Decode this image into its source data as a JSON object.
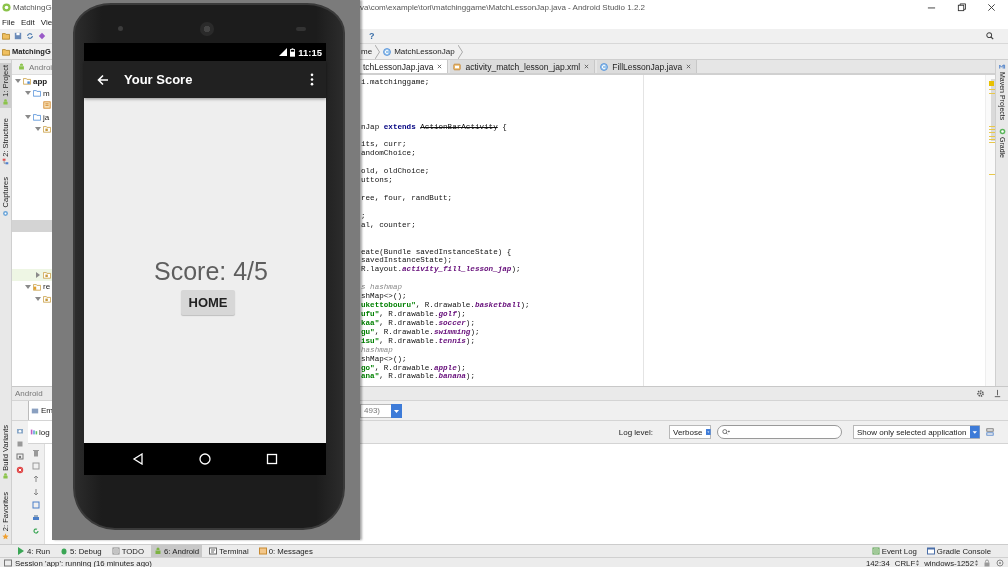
{
  "window": {
    "app_name": "MatchingG",
    "title": "va\\com\\example\\tori\\matchinggame\\MatchLessonJap.java - Android Studio 1.2.2"
  },
  "menu": [
    {
      "label": "File"
    },
    {
      "label": "Edit"
    },
    {
      "label": "Vie"
    }
  ],
  "toolbar": {
    "help": "?"
  },
  "navigation_bar": {
    "project": "MatchingG",
    "crumbs": [
      {
        "label": "me"
      },
      {
        "label": "MatchLessonJap",
        "kind": "class"
      }
    ]
  },
  "left_tool_stripe": {
    "top": [
      {
        "label": "1: Project",
        "kind": "project",
        "selected": true
      },
      {
        "label": "2: Structure",
        "kind": "structure",
        "selected": false
      },
      {
        "label": "Captures",
        "kind": "captures",
        "selected": false
      }
    ],
    "bottom": [
      {
        "label": "Build Variants",
        "kind": "variants",
        "selected": false
      },
      {
        "label": "2: Favorites",
        "kind": "favorites",
        "selected": false
      }
    ]
  },
  "project_panel": {
    "view": "Androi",
    "tree": [
      {
        "label": "app",
        "kind": "module",
        "expanded": true,
        "children": [
          {
            "label": "m",
            "kind": "folder",
            "expanded": true,
            "children": [
              {
                "kind": "file"
              }
            ]
          },
          {
            "label": "ja",
            "kind": "folder",
            "expanded": true,
            "children": [
              {
                "kind": "package",
                "expanded": true,
                "children": [
                  {
                    "selected": false
                  },
                  {
                    "selected": false
                  },
                  {
                    "selected": false
                  },
                  {
                    "selected": false
                  },
                  {
                    "selected": false
                  },
                  {
                    "selected": false
                  },
                  {
                    "selected": false
                  },
                  {
                    "selected": true
                  },
                  {
                    "selected": false
                  },
                  {
                    "selected": false
                  },
                  {
                    "selected": false
                  }
                ]
              },
              {
                "kind": "package",
                "expanded": false,
                "color": "#eef6e4"
              }
            ]
          },
          {
            "label": "re",
            "kind": "res",
            "expanded": true,
            "children": [
              {
                "kind": "package",
                "expanded": true
              }
            ]
          }
        ]
      }
    ]
  },
  "editor_tabs": [
    {
      "label": "tchLessonJap.java",
      "selected": true
    },
    {
      "label": "activity_match_lesson_jap.xml",
      "kind": "xml",
      "selected": false
    },
    {
      "label": "FillLessonJap.java",
      "kind": "class",
      "selected": false
    }
  ],
  "code_lines": [
    {
      "kind": "code",
      "segments": [
        {
          "text": "i.matchinggame;",
          "kind": "plain"
        }
      ]
    },
    {
      "kind": "blank"
    },
    {
      "kind": "blank"
    },
    {
      "kind": "blank"
    },
    {
      "kind": "blank"
    },
    {
      "kind": "code",
      "segments": [
        {
          "text": "nJap ",
          "kind": "plain"
        },
        {
          "text": "extends ",
          "kind": "keyword"
        },
        {
          "text": "ActionBarActivity",
          "kind": "deprecated"
        },
        {
          "text": " {",
          "kind": "plain"
        }
      ]
    },
    {
      "kind": "blank"
    },
    {
      "kind": "code",
      "segments": [
        {
          "text": "its, curr;",
          "kind": "plain"
        }
      ]
    },
    {
      "kind": "code",
      "segments": [
        {
          "text": "andomChoice;",
          "kind": "plain"
        }
      ]
    },
    {
      "kind": "blank"
    },
    {
      "kind": "code",
      "segments": [
        {
          "text": "old, oldChoice;",
          "kind": "plain"
        }
      ]
    },
    {
      "kind": "code",
      "segments": [
        {
          "text": "uttons;",
          "kind": "plain"
        }
      ]
    },
    {
      "kind": "blank"
    },
    {
      "kind": "code",
      "segments": [
        {
          "text": "ree, four, randButt;",
          "kind": "plain"
        }
      ]
    },
    {
      "kind": "blank"
    },
    {
      "kind": "code",
      "segments": [
        {
          "text": ";",
          "kind": "plain"
        }
      ]
    },
    {
      "kind": "code",
      "segments": [
        {
          "text": "al, counter;",
          "kind": "plain"
        }
      ]
    },
    {
      "kind": "blank"
    },
    {
      "kind": "blank"
    },
    {
      "kind": "code",
      "segments": [
        {
          "text": "eate(Bundle savedInstanceState) {",
          "kind": "plain"
        }
      ]
    },
    {
      "kind": "code",
      "segments": [
        {
          "text": "savedInstanceState);",
          "kind": "plain"
        }
      ]
    },
    {
      "kind": "code",
      "segments": [
        {
          "text": "R.layout.",
          "kind": "plain"
        },
        {
          "text": "activity_fill_lesson_jap",
          "kind": "field"
        },
        {
          "text": ");",
          "kind": "plain"
        }
      ]
    },
    {
      "kind": "blank"
    },
    {
      "kind": "code",
      "segments": [
        {
          "text": "s hashmap",
          "kind": "comment"
        }
      ]
    },
    {
      "kind": "code",
      "segments": [
        {
          "text": "shMap<>();",
          "kind": "plain"
        }
      ]
    },
    {
      "kind": "code",
      "segments": [
        {
          "text": "ukettobouru\"",
          "kind": "string"
        },
        {
          "text": ", R.drawable.",
          "kind": "plain"
        },
        {
          "text": "basketball",
          "kind": "field"
        },
        {
          "text": ");",
          "kind": "plain"
        }
      ]
    },
    {
      "kind": "code",
      "segments": [
        {
          "text": "ufu\"",
          "kind": "string"
        },
        {
          "text": ", R.drawable.",
          "kind": "plain"
        },
        {
          "text": "golf",
          "kind": "field"
        },
        {
          "text": ");",
          "kind": "plain"
        }
      ]
    },
    {
      "kind": "code",
      "segments": [
        {
          "text": "kaa\"",
          "kind": "string"
        },
        {
          "text": ", R.drawable.",
          "kind": "plain"
        },
        {
          "text": "soccer",
          "kind": "field"
        },
        {
          "text": ");",
          "kind": "plain"
        }
      ]
    },
    {
      "kind": "code",
      "segments": [
        {
          "text": "gu\"",
          "kind": "string"
        },
        {
          "text": ", R.drawable.",
          "kind": "plain"
        },
        {
          "text": "swimming",
          "kind": "field"
        },
        {
          "text": ");",
          "kind": "plain"
        }
      ]
    },
    {
      "kind": "code",
      "segments": [
        {
          "text": "isu\"",
          "kind": "string"
        },
        {
          "text": ", R.drawable.",
          "kind": "plain"
        },
        {
          "text": "tennis",
          "kind": "field"
        },
        {
          "text": ");",
          "kind": "plain"
        }
      ]
    },
    {
      "kind": "code",
      "segments": [
        {
          "text": "hashmap",
          "kind": "comment"
        }
      ]
    },
    {
      "kind": "code",
      "segments": [
        {
          "text": "shMap<>();",
          "kind": "plain"
        }
      ]
    },
    {
      "kind": "code",
      "segments": [
        {
          "text": "go\"",
          "kind": "string"
        },
        {
          "text": ", R.drawable.",
          "kind": "plain"
        },
        {
          "text": "apple",
          "kind": "field"
        },
        {
          "text": ");",
          "kind": "plain"
        }
      ]
    },
    {
      "kind": "code",
      "segments": [
        {
          "text": "ana\"",
          "kind": "string"
        },
        {
          "text": ", R.drawable.",
          "kind": "plain"
        },
        {
          "text": "banana",
          "kind": "field"
        },
        {
          "text": ");",
          "kind": "plain"
        }
      ]
    }
  ],
  "right_tool_stripe": [
    {
      "label": "Maven Projects",
      "kind": "maven"
    },
    {
      "label": "Gradle",
      "kind": "gradle"
    }
  ],
  "bottom_panel": {
    "title": "Android",
    "tabs": [
      {
        "label": "Em",
        "selected": true
      }
    ],
    "process": "493)",
    "logcat_tab": {
      "label": "log",
      "selected": true
    },
    "log_level_label": "Log level:",
    "log_level": "Verbose",
    "filter": "Show only selected application"
  },
  "tool_windows": [
    {
      "label": "4: Run",
      "kind": "run",
      "selected": false
    },
    {
      "label": "5: Debug",
      "kind": "debug",
      "selected": false
    },
    {
      "label": "TODO",
      "kind": "todo",
      "selected": false
    },
    {
      "label": "6: Android",
      "kind": "android",
      "selected": true
    },
    {
      "label": "Terminal",
      "kind": "terminal",
      "selected": false
    },
    {
      "label": "0: Messages",
      "kind": "messages",
      "selected": false
    }
  ],
  "tool_windows_right": [
    {
      "label": "Event Log",
      "kind": "event"
    },
    {
      "label": "Gradle Console",
      "kind": "console"
    }
  ],
  "status_bar": {
    "message": "Session 'app': running (16 minutes ago)",
    "position": "142:34",
    "line_separator": "CRLF",
    "encoding": "windows-1252"
  },
  "emulator": {
    "time": "11:15",
    "title": "Your Score",
    "score": "Score: 4/5",
    "button": "HOME"
  }
}
